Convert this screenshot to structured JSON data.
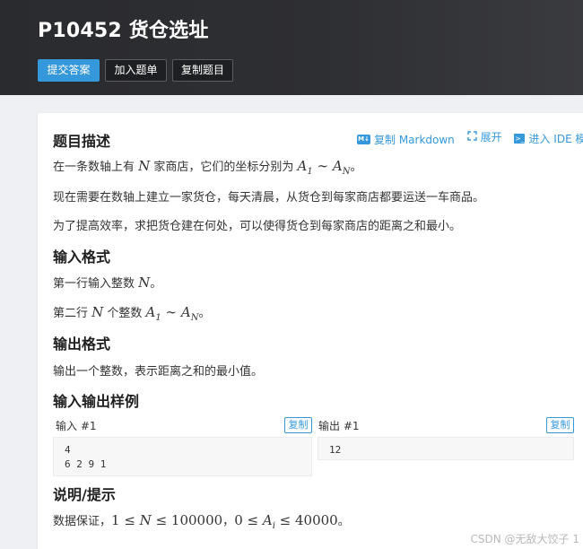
{
  "header": {
    "title": "P10452 货仓选址",
    "buttons": {
      "submit": "提交答案",
      "join": "加入题单",
      "copy": "复制题目"
    }
  },
  "toolbar": {
    "copy_markdown": "复制 Markdown",
    "copy_markdown_icon": "M↓",
    "expand": "展开",
    "ide": "进入 IDE 模式",
    "ide_icon": ">_"
  },
  "sections": {
    "description": {
      "heading": "题目描述",
      "p1_pre": "在一条数轴上有 ",
      "p1_n": "N",
      "p1_mid": " 家商店，它们的坐标分别为 ",
      "p1_a1": "A",
      "p1_a1_sub": "1",
      "p1_sim": " ∼ ",
      "p1_an": "A",
      "p1_an_sub": "N",
      "p1_end": "。",
      "p2": "现在需要在数轴上建立一家货仓，每天清晨，从货仓到每家商店都要运送一车商品。",
      "p3": "为了提高效率，求把货仓建在何处，可以使得货仓到每家商店的距离之和最小。"
    },
    "input_format": {
      "heading": "输入格式",
      "l1_pre": "第一行输入整数 ",
      "l1_n": "N",
      "l1_end": "。",
      "l2_pre": "第二行 ",
      "l2_n": "N",
      "l2_mid": " 个整数 ",
      "l2_a1": "A",
      "l2_a1_sub": "1",
      "l2_sim": " ∼ ",
      "l2_an": "A",
      "l2_an_sub": "N",
      "l2_end": "。"
    },
    "output_format": {
      "heading": "输出格式",
      "l1": "输出一个整数，表示距离之和的最小值。"
    },
    "samples": {
      "heading": "输入输出样例",
      "input_label": "输入 #1",
      "output_label": "输出 #1",
      "copy_label": "复制",
      "input_value": "4\n6 2 9 1",
      "output_value": "12"
    },
    "hint": {
      "heading": "说明/提示",
      "pre": "数据保证，",
      "c1": "1",
      "le1": " ≤ ",
      "n": "N",
      "le2": " ≤ ",
      "c2": "100000",
      "sep": "，",
      "c3": "0",
      "le3": " ≤ ",
      "a": "A",
      "a_sub": "i",
      "le4": " ≤ ",
      "c4": "40000",
      "end": "。"
    }
  },
  "watermark": "CSDN @无敌大饺子 1"
}
